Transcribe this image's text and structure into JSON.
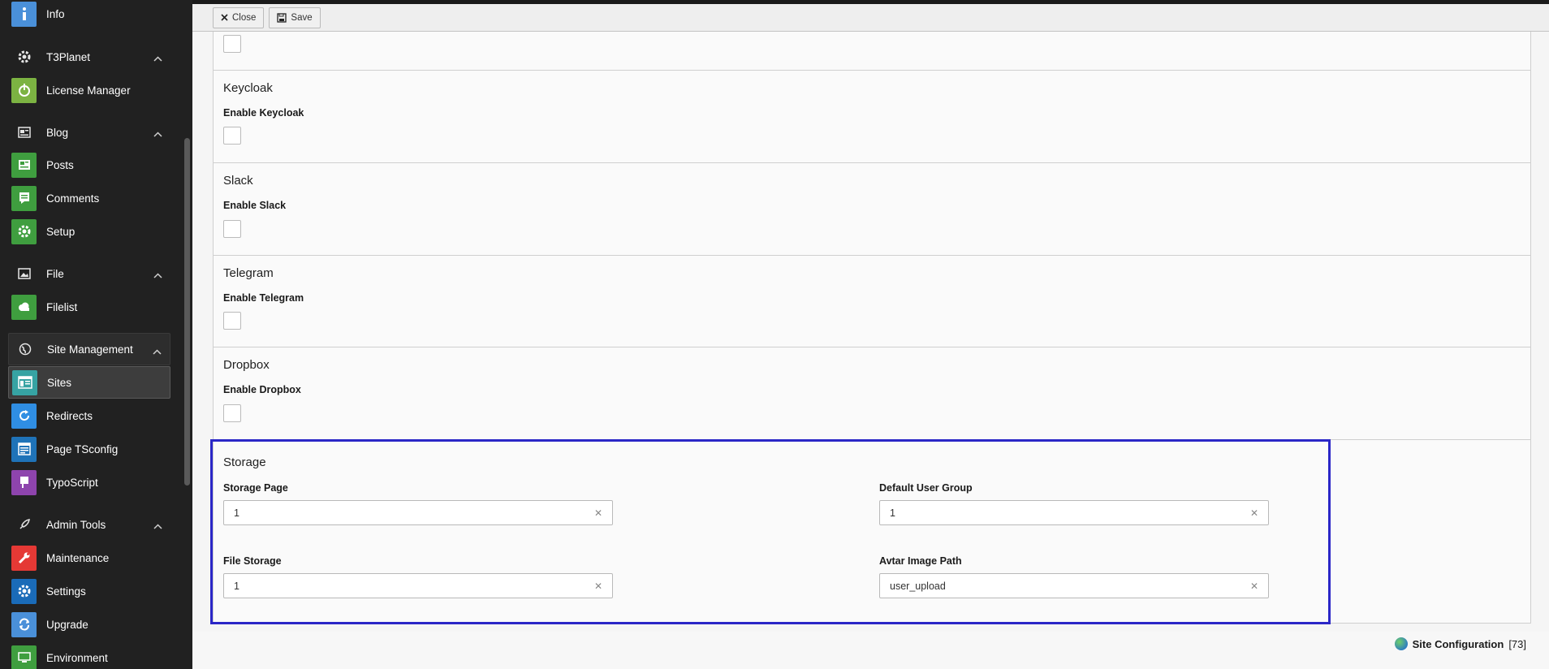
{
  "sidebar": {
    "items": [
      {
        "label": "Info",
        "icon": "info-icon",
        "color": "#4a90d9"
      },
      {
        "label": "T3Planet",
        "icon": "gear-icon",
        "group": true
      },
      {
        "label": "License Manager",
        "icon": "power-icon",
        "color": "#7cb342"
      },
      {
        "label": "Blog",
        "icon": "blog-icon",
        "group": true
      },
      {
        "label": "Posts",
        "icon": "posts-icon",
        "color": "#3f9e3f"
      },
      {
        "label": "Comments",
        "icon": "comments-icon",
        "color": "#3f9e3f"
      },
      {
        "label": "Setup",
        "icon": "gear-icon",
        "color": "#3f9e3f"
      },
      {
        "label": "File",
        "icon": "file-icon",
        "group": true
      },
      {
        "label": "Filelist",
        "icon": "cloud-icon",
        "color": "#3f9e3f"
      },
      {
        "label": "Site Management",
        "icon": "globe-icon",
        "group": true
      },
      {
        "label": "Sites",
        "icon": "sites-icon",
        "color": "#36a3a3"
      },
      {
        "label": "Redirects",
        "icon": "redirects-icon",
        "color": "#2f8ee3"
      },
      {
        "label": "Page TSconfig",
        "icon": "tsconfig-icon",
        "color": "#1f73b8"
      },
      {
        "label": "TypoScript",
        "icon": "typoscript-icon",
        "color": "#8e44ad"
      },
      {
        "label": "Admin Tools",
        "icon": "rocket-icon",
        "group": true
      },
      {
        "label": "Maintenance",
        "icon": "wrench-icon",
        "color": "#e53935"
      },
      {
        "label": "Settings",
        "icon": "gear-icon",
        "color": "#1a6bb8"
      },
      {
        "label": "Upgrade",
        "icon": "upgrade-icon",
        "color": "#4a90d9"
      },
      {
        "label": "Environment",
        "icon": "environment-icon",
        "color": "#3f9e3f"
      }
    ]
  },
  "toolbar": {
    "close_label": "Close",
    "save_label": "Save"
  },
  "sections": [
    {
      "title": "Keycloak",
      "field_label": "Enable Keycloak"
    },
    {
      "title": "Slack",
      "field_label": "Enable Slack"
    },
    {
      "title": "Telegram",
      "field_label": "Enable Telegram"
    },
    {
      "title": "Dropbox",
      "field_label": "Enable Dropbox"
    }
  ],
  "storage": {
    "title": "Storage",
    "storage_page_label": "Storage Page",
    "storage_page_value": "1",
    "default_user_group_label": "Default User Group",
    "default_user_group_value": "1",
    "file_storage_label": "File Storage",
    "file_storage_value": "1",
    "avatar_path_label": "Avtar Image Path",
    "avatar_path_value": "user_upload"
  },
  "footer": {
    "record_label": "Site Configuration",
    "record_id": "[73]"
  },
  "colors": {
    "highlight": "#2b27c7"
  }
}
